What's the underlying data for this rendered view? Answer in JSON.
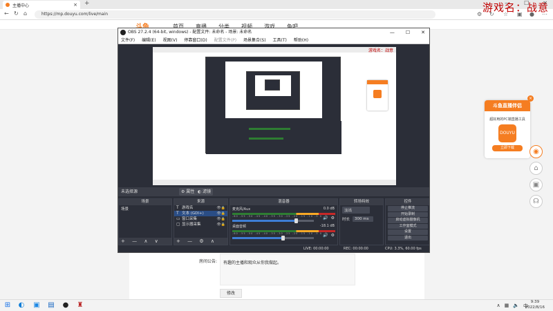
{
  "browser": {
    "tab_title": "主播中心",
    "new_tab": "+",
    "url": "https://mp.douyu.com/live/main",
    "controls": [
      "—",
      "☐",
      "✕"
    ]
  },
  "watermark": "游戏名：战意",
  "douyu": {
    "logo": "斗鱼",
    "nav": [
      "首页",
      "直播",
      "分类",
      "视频",
      "游戏",
      "鱼吧"
    ],
    "notice_label": "房间公告:",
    "notice_text": "有趣的主播和观众从你我做起。",
    "edit_button": "修改",
    "promo": {
      "title": "斗鱼直播伴侣",
      "desc": "超好用的PC端直播工具",
      "logo": "DOUYU",
      "button": "立即下载"
    }
  },
  "obs": {
    "title": "OBS 27.2.4 (64-bit, windows) - 配置文件: 未命名 - 场景: 未命名",
    "menu": [
      "文件(F)",
      "编辑(E)",
      "视图(V)",
      "停靠窗口(D)",
      "配置文件(P)",
      "场景集合(S)",
      "工具(T)",
      "帮助(H)"
    ],
    "no_source": "未选择源",
    "properties_btn": "⚙ 属性",
    "filters_btn": "◐ 滤镜",
    "docks": {
      "scenes": "场景",
      "sources": "来源",
      "mixer": "混音器",
      "transitions": "转场特效",
      "controls": "控件"
    },
    "scenes": [
      "场景"
    ],
    "sources": [
      {
        "icon": "T",
        "name": "游戏名"
      },
      {
        "icon": "T",
        "name": "文本 (GDI+)"
      },
      {
        "icon": "▭",
        "name": "窗口采集"
      },
      {
        "icon": "▢",
        "name": "显示器采集"
      }
    ],
    "mixer": [
      {
        "name": "麦克风/Aux",
        "db": "0.0 dB",
        "level": 0.78
      },
      {
        "name": "桌面音频",
        "db": "-18.1 dB",
        "level": 0.62
      }
    ],
    "meter_scale": "-60 -55 -50 -45 -40 -35 -30 -25 -20 -15 -10 -5 0",
    "transition": {
      "type": "淡出",
      "duration_label": "时长",
      "duration": "300 ms"
    },
    "controls": [
      "停止推流",
      "开始录制",
      "启动虚拟摄像机",
      "工作室模式",
      "设置",
      "退出"
    ],
    "footer_buttons": "+ — ∧ ∨",
    "source_footer": "+ — ⚙ ∧ ∨",
    "status": {
      "live": "LIVE: 00:00:00",
      "rec": "REC: 00:00:00",
      "cpu": "CPU: 3.3%, 60.00 fps"
    }
  },
  "taskbar": {
    "time": "9:39",
    "date": "2022/8/16",
    "lang": "中"
  }
}
